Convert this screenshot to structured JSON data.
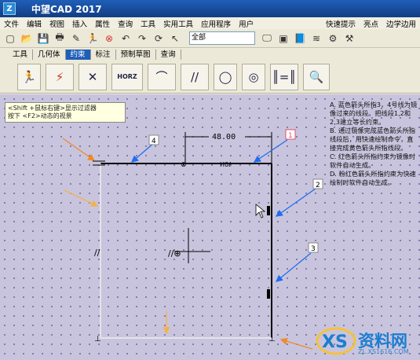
{
  "window": {
    "title": "中望CAD 2017"
  },
  "menu": {
    "items": [
      "文件",
      "编辑",
      "视图",
      "插入",
      "属性",
      "查询",
      "工具",
      "实用工具",
      "应用程序",
      "用户"
    ],
    "right_items": [
      "快速提示",
      "亮点",
      "边学边用"
    ]
  },
  "toolbar": {
    "layer_combo": "全部"
  },
  "tabs": [
    "工具",
    "几何体",
    "约束",
    "标注",
    "预制草图",
    "查询"
  ],
  "active_tab": "约束",
  "constraint_tools": {
    "horz_label": "HORZ"
  },
  "canvas": {
    "tooltip": [
      "<Shift +鼠标右键>显示过滤器",
      "按下 <F2>动态的视景"
    ],
    "dimension_text": "48.00",
    "dim_label": "H0ℓ",
    "callouts": [
      "4",
      "1",
      "2",
      "3"
    ],
    "notes": [
      "A. 蓝色箭头所指3，4号线为镜像过来的线段。把线段1,2和2,3建立等长约束。",
      "B. 通过镜像完成蓝色箭头所指线段后，用快速绘制命令，直接完成黄色箭头所指线段。",
      "C. 红色箭头所指约束为镜像时软件自动生成。",
      "D. 粉红色箭头所指约束为快速绘制时软件自动生成。"
    ]
  },
  "watermark": {
    "text": "资料网",
    "url": "ZL.XS1616.COM"
  },
  "colors": {
    "canvas_bg": "#c9c4dd",
    "blue_arrow": "#1e6ef0",
    "orange_arrow": "#f08a28",
    "yellow_arrow": "#f3b24a",
    "pink_label": "#e0506a"
  }
}
